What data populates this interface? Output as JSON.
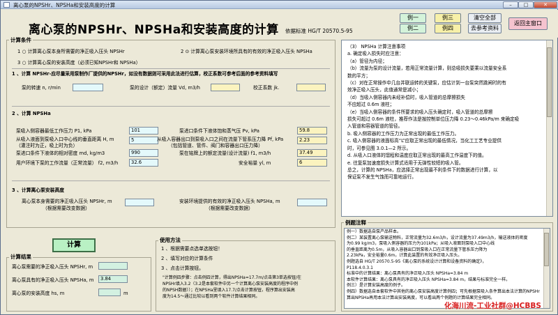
{
  "window": {
    "title": "离心泵的NPSHr、NPSHa和安装高度的计算",
    "min": "–",
    "max": "□",
    "close": "✕"
  },
  "header": {
    "title": "离心泵的NPSHr、NPSHa和安装高度的计算",
    "standard": "依据标准 HG/T 20570.5-95"
  },
  "buttons": {
    "ex1": "例一",
    "ex2": "例二",
    "ex3": "例三",
    "ex4": "例四",
    "clear_all": "清空全部",
    "view_data": "去参考资料",
    "back_main": "返回主窗口",
    "calc": "计算"
  },
  "conditions": {
    "legend": "计算条件",
    "opt1": "1 ○ 计算离心泵本身所需要的净正吸入压头 NPSHr",
    "opt2": "2 ⊙ 计算离心泵安装环境所具有的有效的净正吸入压头 NPSHa",
    "opt3": "3 ○ 计算离心泵的安装高度（必须已知NPSHr和 NPSHa）",
    "sec1_title": "1 、计算 NPSHr-应尽量采用泵制作厂提供的NPSHr，如没有数据则可采用此法进行估算，校正系数可参考后面的参考资料填写",
    "sec1_rpm_label": "泵的转速 n, r/min",
    "sec1_rpm": "",
    "sec1_flow_label": "泵的设计（额定）流量 Vd, m3/h",
    "sec1_flow": "",
    "sec1_k_label": "校正系数 jk.",
    "sec1_k": "",
    "sec2_title": "2 、计算 NPSHa",
    "sec2_p1_label": "泵吸入侧容器最低工作压力 P1, kPa",
    "sec2_p1": "101",
    "sec2_pv_label": "泵进口条件下液体饱和蒸气压 Pv, kPa",
    "sec2_pv": "59.8",
    "sec2_h_label1": "从吸入液面到泵吸入口中心线的垂直距离 H, m",
    "sec2_h_label2": "（灌注时为正，吸上时为负）",
    "sec2_h": "5",
    "sec2_pf_label1": "从吸入容器出口到泵吸入口之间在流量下管系压力降 Pf, kPa",
    "sec2_pf_label2": "（包括管道、管件、阀门和容器出口压力降）",
    "sec2_pf": "2.23",
    "sec2_rho_label": "泵进口条件下液体的相对密度 md, kg/m3",
    "sec2_rho": "990",
    "sec2_v_label": "泵在铭牌上的额定流量(设计流量) f1, m3/h",
    "sec2_v": "37.49",
    "sec2_q_label": "用户环境下泵的工作流量（正常流量） f2, m3/h",
    "sec2_q": "32.6",
    "sec2_sf_label": "安全裕量 yl, m",
    "sec2_sf": "6",
    "sec3_title": "3 、计算离心泵安装高度",
    "sec3_r_label1": "离心泵本身需要的净正吸入压头 NPSHr, m",
    "sec3_r_label2": "（根据需要改变数据）",
    "sec3_a_label1": "安装环境提供的有效的净正吸入压头 NPSHa, m",
    "sec3_a_label2": "（根据需要改变数据）",
    "sec3_r": "",
    "sec3_a": ""
  },
  "results": {
    "legend": "计算结果",
    "r_label": "离心泵需要的净正吸入压头 NPSHr, m",
    "r": "",
    "a_label": "离心泵具有的净正吸入压头 NPSHa, m",
    "a": "3.84",
    "hs_label": "离心泵的安装高度 hs, m",
    "hs": "",
    "hs_unit": "m"
  },
  "usage": {
    "legend": "使用方法",
    "l1": "1 、根据需要点选单选按钮！",
    "l2": "2 、填写对应的计算条件",
    "l3": "3 、点击计算按钮。",
    "l4": "\"计算例四步骤：点击例四计算，得出NPSHa=17.7m/点击第3单选按钮/在",
    "l5": "NPSHr填入3.2（3.2是本套软件中另一个计算离心泵安装高度的程序中例",
    "l6": "的NPSH数据））；在NPSHa里填入17.7/点击计算按钮，程序算出安装高",
    "l7": "度为14.5～通过比较以看到两个软件计算结果相同。"
  },
  "notes": {
    "lines": [
      "（3）  NPSHa 计算注意事项",
      "a. 确定吸入损失时应注意：",
      "（a）管径为内径；",
      "（b）流量为泵的设计流量，若用正常流量计算，则总吸损失要乘以流量安全系",
      "数的平方；",
      "（c）对在正常操作中几台并联运转的关键泵，应估计到一台泵突然跳闸时的有",
      "效净正吸入压头，此值通常是减小；",
      "（d）当吸入侧容器内未经补偿时，吸入管道的总摩擦损失",
      "不应超过 0.6m 液柱；",
      "（e）当吸入侧容器的条件所要求的吸入压头确定时，吸入管道的总摩擦",
      "损失可超过 0.6m 液柱，推荐作法是按控制单位压力降 0.23～0.46kPa/m 来确定吸",
      "入管道和容器管道的管径。",
      "b. 吸入侧容器的工作压力为正常出现的最低工作压力。",
      "c. 吸入侧容器的液面标高“L”应取正常出现的最低情况，当化工工艺专业提供",
      "时，可参见图 3.0.1—2 所示。",
      "d. 从吸入口液体的馏程和温度应取正常出现的最高工作温度下的值。",
      "e. 往复泵加速度损失计算式适用于无弹性较短的吸入管。",
      "总之，计算的 NPSHa，应选择正常出现最不利条件下的数据进行计算，以",
      "保证泵不发生气蚀而可靠地运行。"
    ]
  },
  "examples": {
    "legend": "例题注释",
    "lines": [
      "例一）数据选自泵产品样本。",
      "例二）某装置离心泵输送物料，正常流量为32.6m3/h，设计流量为37.49m3/h，输送液体的密度",
      "为0.99 kg/m3，泵吸入侧容器的压力为101kPa；从吸入液面到泵吸入口中心线",
      "的垂直距离为0.5m，从吸入容器出口到泵吸入口在正常流量下管系压力降为",
      "2.23kPa，安全裕量0.6m，计算此装置的有效净正吸入压头。",
      "例题选自 HG/T 20570.5-95《离心泵的系统设计计算和设备资料的确定》，",
      "P118.4.0.3.1",
      "标准中的计算结果：离心泵具有的净正吸入压头 NPSHa=3.84 m",
      "本软件计算结果：离心泵具有的净正吸入压头 NPSHa=3.84 m，结果与标准完全一样。",
      "例三）是计算安装高度的例子。",
      "例四）数据选自本套软件中其他的离心泵安装高度计算例四；可先根据泵吸入条件算出本法计算的NPSHr",
      "算出NPSHa再用本法计算出安装高度，可以看出两个例题的计算结果完全相同。"
    ]
  },
  "watermark": "化海川流-工业社群@HCBBS"
}
